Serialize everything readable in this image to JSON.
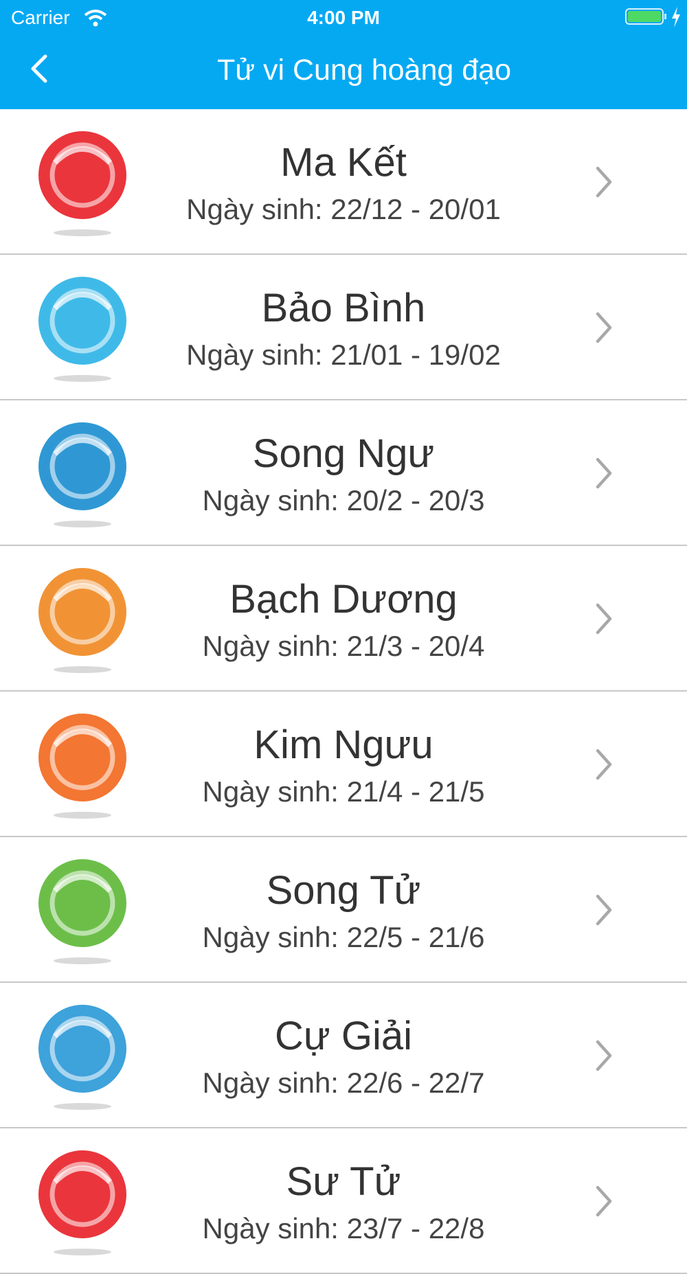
{
  "status_bar": {
    "carrier": "Carrier",
    "time": "4:00 PM"
  },
  "nav": {
    "title": "Tử vi Cung hoàng đạo",
    "back_icon": "chevron-left-icon"
  },
  "colors": {
    "header": "#05a9f2",
    "text": "#333333",
    "separator": "#c8c8c8"
  },
  "signs": [
    {
      "name": "Ma Kết",
      "dates": "Ngày sinh: 22/12 - 20/01",
      "icon": "capricorn-icon",
      "color": "#e8242b"
    },
    {
      "name": "Bảo Bình",
      "dates": "Ngày sinh: 21/01 - 19/02",
      "icon": "aquarius-icon",
      "color": "#2fb4e6"
    },
    {
      "name": "Song Ngư",
      "dates": "Ngày sinh: 20/2 - 20/3",
      "icon": "pisces-icon",
      "color": "#1d8fd0"
    },
    {
      "name": "Bạch Dương",
      "dates": "Ngày sinh: 21/3 - 20/4",
      "icon": "aries-icon",
      "color": "#f08a24"
    },
    {
      "name": "Kim Ngưu",
      "dates": "Ngày sinh: 21/4 - 21/5",
      "icon": "taurus-icon",
      "color": "#f26a21"
    },
    {
      "name": "Song Tử",
      "dates": "Ngày sinh: 22/5 - 21/6",
      "icon": "gemini-icon",
      "color": "#5fb83a"
    },
    {
      "name": "Cự Giải",
      "dates": "Ngày sinh: 22/6 - 22/7",
      "icon": "cancer-icon",
      "color": "#2e9ad8"
    },
    {
      "name": "Sư Tử",
      "dates": "Ngày sinh: 23/7 - 22/8",
      "icon": "leo-icon",
      "color": "#e8242b"
    }
  ]
}
